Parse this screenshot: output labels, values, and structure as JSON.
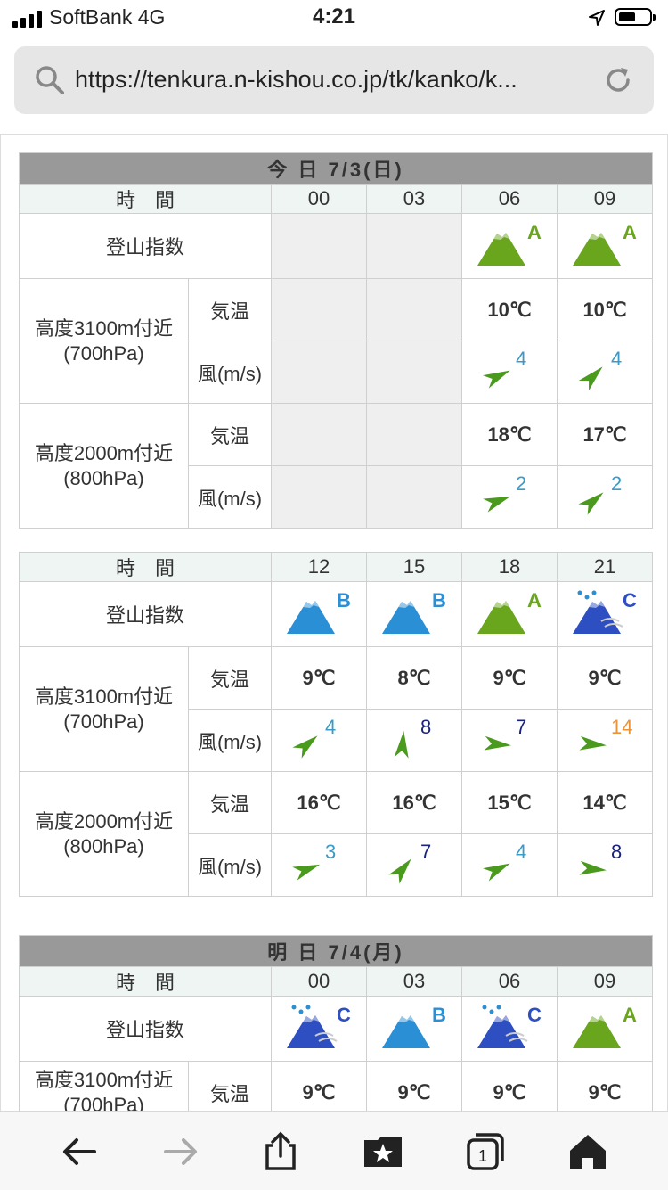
{
  "status": {
    "carrier": "SoftBank  4G",
    "time": "4:21",
    "battery_level": 0.55
  },
  "browser": {
    "url": "https://tenkura.n-kishou.co.jp/tk/kanko/k..."
  },
  "labels": {
    "time": "時　間",
    "index": "登山指数",
    "temp": "気温",
    "wind": "風(m/s)",
    "h3100": "高度3100m付近",
    "p700": "(700hPa)",
    "h2000": "高度2000m付近",
    "p800": "(800hPa)"
  },
  "blocks": [
    {
      "day": "今 日  7/3(日)",
      "times": [
        "00",
        "03",
        "06",
        "09"
      ],
      "icons": [
        null,
        null,
        "A",
        "A"
      ],
      "t700": [
        "",
        "",
        "10℃",
        "10℃"
      ],
      "w700": [
        null,
        null,
        {
          "s": "4",
          "c": "#3a9bc8",
          "r": -25
        },
        {
          "s": "4",
          "c": "#3a9bc8",
          "r": -45
        }
      ],
      "t800": [
        "",
        "",
        "18℃",
        "17℃"
      ],
      "w800": [
        null,
        null,
        {
          "s": "2",
          "c": "#3a9bc8",
          "r": -20
        },
        {
          "s": "2",
          "c": "#3a9bc8",
          "r": -40
        }
      ]
    },
    {
      "day": "",
      "times": [
        "12",
        "15",
        "18",
        "21"
      ],
      "icons": [
        "B",
        "B",
        "A",
        "C"
      ],
      "t700": [
        "9℃",
        "8℃",
        "9℃",
        "9℃"
      ],
      "w700": [
        {
          "s": "4",
          "c": "#3a9bc8",
          "r": -40
        },
        {
          "s": "8",
          "c": "#1a237e",
          "r": -85
        },
        {
          "s": "7",
          "c": "#1a237e",
          "r": 5
        },
        {
          "s": "14",
          "c": "#e8943a",
          "r": 5
        }
      ],
      "t800": [
        "16℃",
        "16℃",
        "15℃",
        "14℃"
      ],
      "w800": [
        {
          "s": "3",
          "c": "#3a9bc8",
          "r": -20
        },
        {
          "s": "7",
          "c": "#1a237e",
          "r": -50
        },
        {
          "s": "4",
          "c": "#3a9bc8",
          "r": -25
        },
        {
          "s": "8",
          "c": "#1a237e",
          "r": 5
        }
      ]
    },
    {
      "day": "明 日  7/4(月)",
      "times": [
        "00",
        "03",
        "06",
        "09"
      ],
      "icons": [
        "C",
        "B",
        "C",
        "A"
      ],
      "t700": [
        "9℃",
        "9℃",
        "9℃",
        "9℃"
      ]
    }
  ],
  "colors": {
    "A": "#6aa51e",
    "B": "#2b8fd6",
    "C": "#2e4fc1"
  }
}
